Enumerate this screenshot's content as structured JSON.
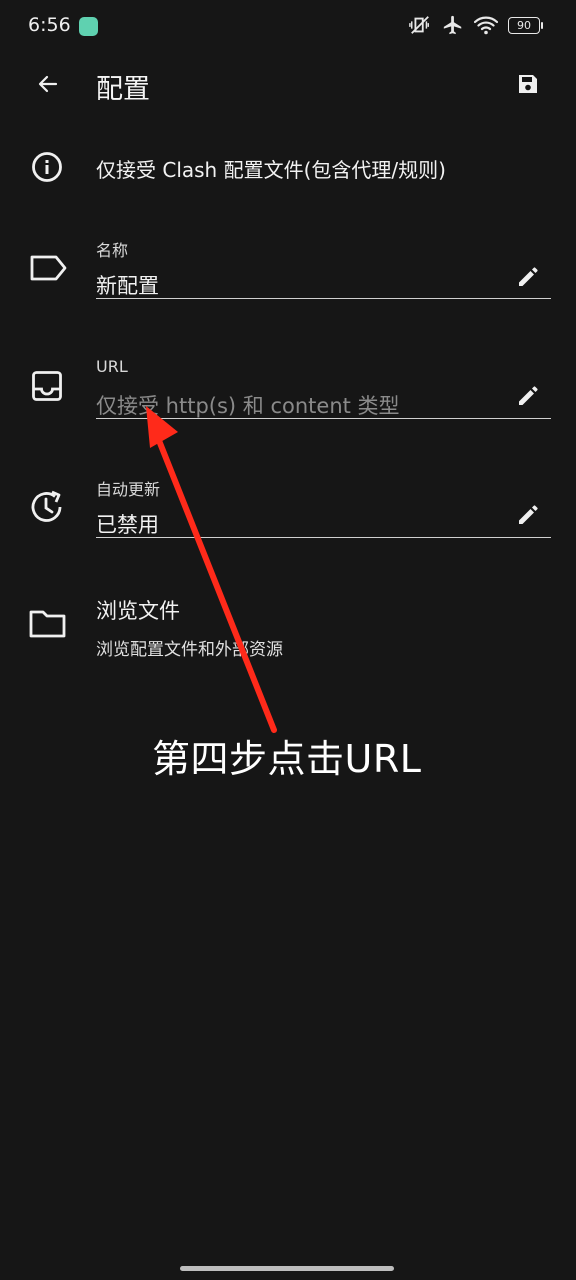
{
  "status_bar": {
    "time": "6:56",
    "battery": "90"
  },
  "toolbar": {
    "title": "配置"
  },
  "info": {
    "text": "仅接受 Clash 配置文件(包含代理/规则)"
  },
  "fields": {
    "name": {
      "label": "名称",
      "value": "新配置"
    },
    "url": {
      "label": "URL",
      "placeholder": "仅接受 http(s) 和 content 类型"
    },
    "auto_update": {
      "label": "自动更新",
      "value": "已禁用"
    }
  },
  "browse": {
    "title": "浏览文件",
    "subtitle": "浏览配置文件和外部资源"
  },
  "annotation": {
    "text": "第四步点击URL",
    "arrow_color": "#ff2a1a"
  }
}
